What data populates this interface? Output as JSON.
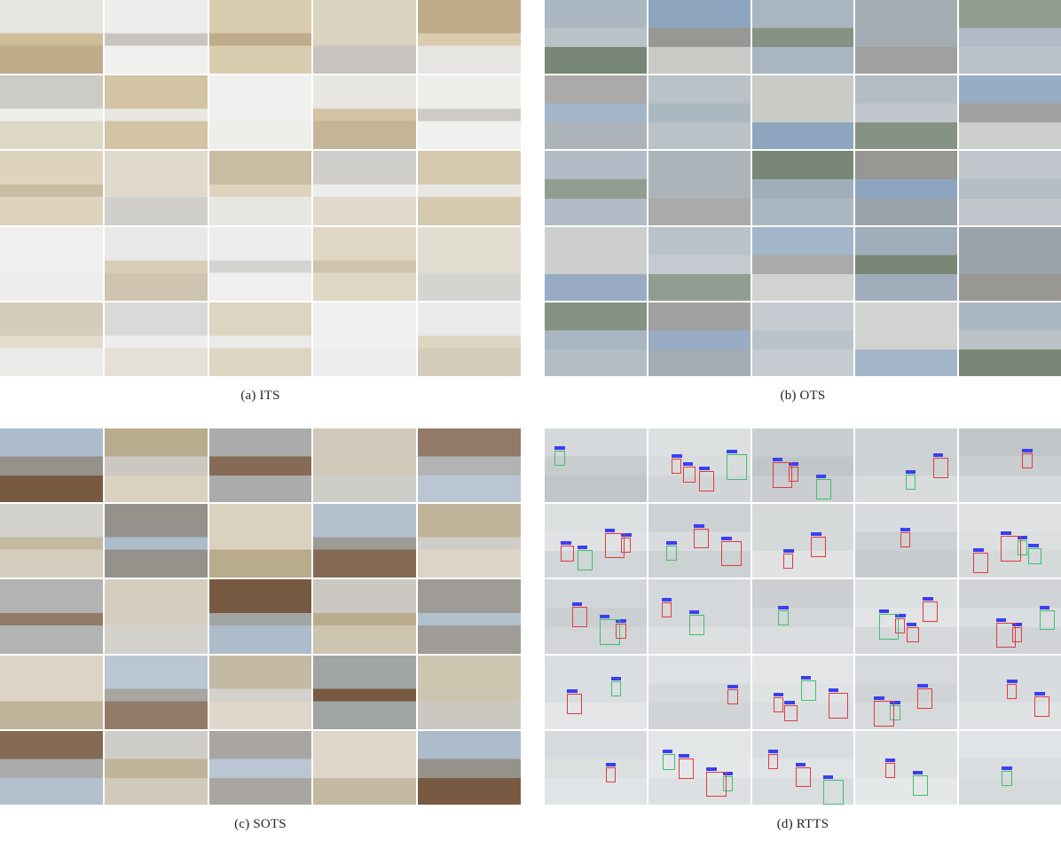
{
  "panels": [
    {
      "id": "its",
      "caption": "(a) ITS",
      "palette": [
        "#e7e4de",
        "#d9cfb8",
        "#c9b58a",
        "#efeeea",
        "#b9a27a",
        "#f2f1ee",
        "#d8c7a3",
        "#c2bfb8"
      ]
    },
    {
      "id": "ots",
      "caption": "(b) OTS",
      "palette": [
        "#a7b3bd",
        "#8d98a0",
        "#b6bec4",
        "#7f9ab7",
        "#6f7e6c",
        "#c4c6c2",
        "#9aa9b8",
        "#8b8a86"
      ]
    },
    {
      "id": "sots",
      "caption": "(c) SOTS",
      "palette": [
        "#a7b8c8",
        "#c9bfa8",
        "#8e8a84",
        "#b1a27f",
        "#6e4e34",
        "#d8cdb8",
        "#9a9e9c",
        "#c6c3bb"
      ]
    },
    {
      "id": "rtts",
      "caption": "(d) RTTS",
      "palette": [
        "#c9ced0",
        "#bdc3c6",
        "#b4babd",
        "#d6d9d9",
        "#a9b0b3",
        "#c3c8c9",
        "#b8bec0",
        "#cfd3d3"
      ]
    }
  ]
}
